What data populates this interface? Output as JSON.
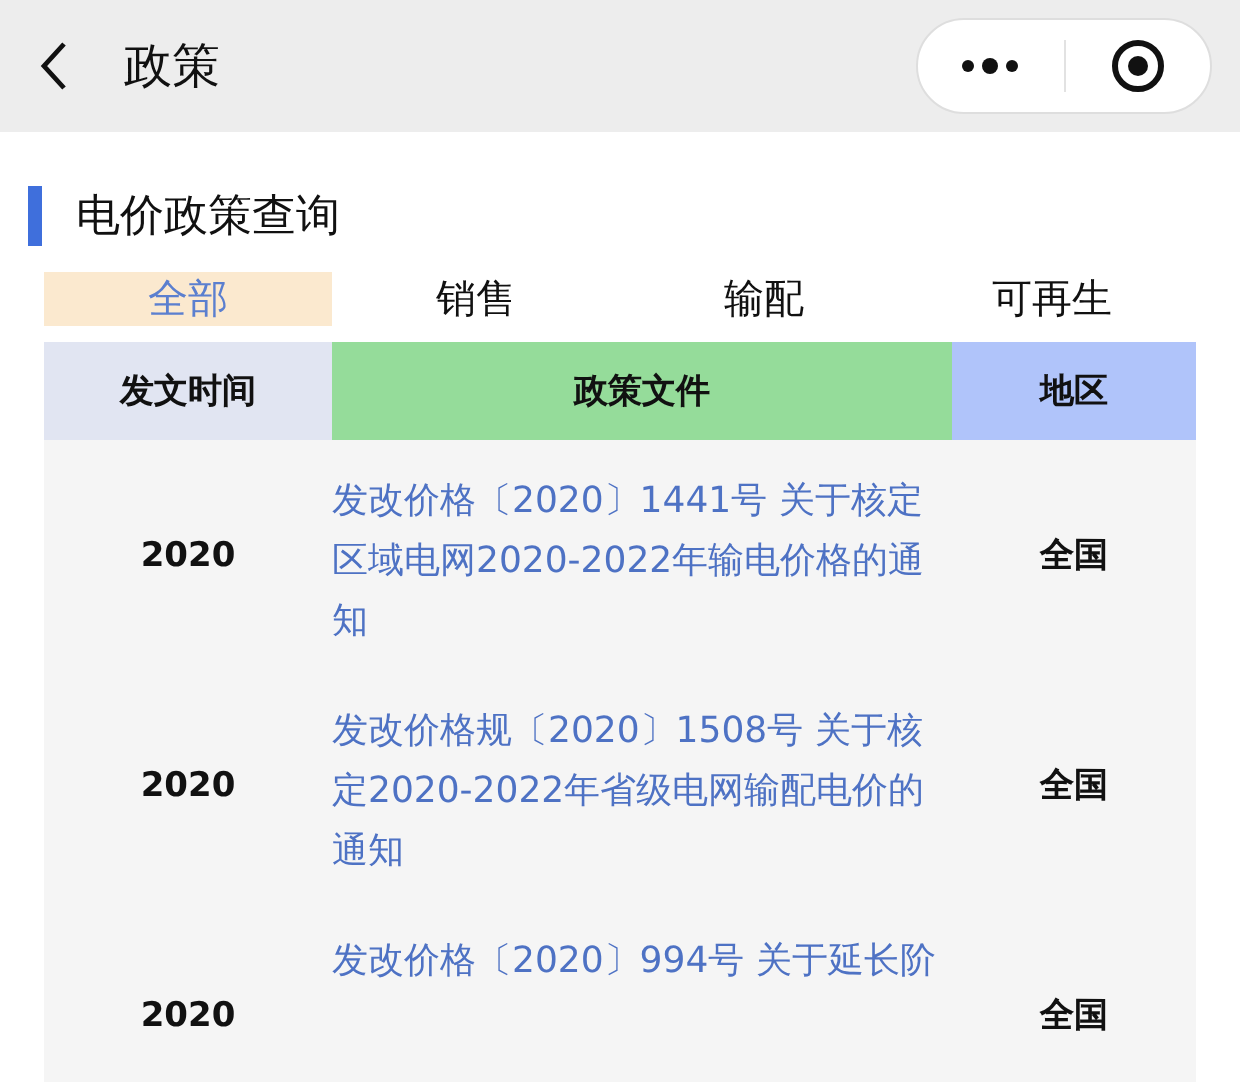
{
  "nav": {
    "title": "政策"
  },
  "section": {
    "title": "电价政策查询"
  },
  "tabs": [
    {
      "label": "全部",
      "selected": true
    },
    {
      "label": "销售",
      "selected": false
    },
    {
      "label": "输配",
      "selected": false
    },
    {
      "label": "可再生",
      "selected": false
    }
  ],
  "table": {
    "columns": [
      "发文时间",
      "政策文件",
      "地区"
    ],
    "rows": [
      {
        "year": "2020",
        "document": "发改价格〔2020〕1441号 关于核定区域电网2020-2022年输电价格的通知",
        "region": "全国"
      },
      {
        "year": "2020",
        "document": "发改价格规〔2020〕1508号 关于核定2020-2022年省级电网输配电价的通知",
        "region": "全国"
      },
      {
        "year": "2020",
        "document": "发改价格〔2020〕994号 关于延长阶",
        "region": "全国"
      }
    ]
  }
}
